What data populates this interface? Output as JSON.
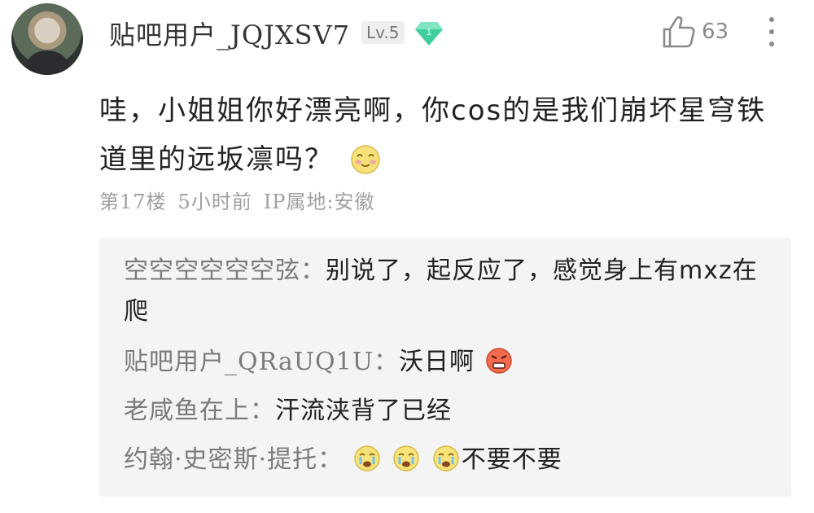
{
  "comment": {
    "username": "贴吧用户_JQJXSV7",
    "level_badge": "Lv.5",
    "gem_badge": "1",
    "like_count": "63",
    "text": "哇，小姐姐你好漂亮啊，你cos的是我们崩坏星穹铁道里的远坂凛吗？",
    "floor": "第17楼",
    "time": "5小时前",
    "ip_location": "IP属地:安徽",
    "icons": {
      "avatar": "user-avatar",
      "gem": "gem-badge-icon",
      "like": "thumbs-up-icon",
      "more": "more-vertical-icon",
      "text_emoji": "blush-face-emoji"
    }
  },
  "replies": [
    {
      "name": "空空空空空空弦：",
      "text": "别说了，起反应了，感觉身上有mxz在爬"
    },
    {
      "name": "贴吧用户_QRaUQ1U：",
      "text": "沃日啊",
      "emoji": "angry-face-emoji"
    },
    {
      "name": "老咸鱼在上：",
      "text": "汗流浃背了已经"
    },
    {
      "name": "约翰·史密斯·提托：",
      "text": "不要不要",
      "emoji": "crying-face-emoji"
    }
  ],
  "colors": {
    "username": "#333333",
    "meta": "#a0a0a0",
    "reply_bg": "#f4f4f4",
    "reply_name": "#7b7b7b",
    "gem": "#3fcf9c"
  }
}
